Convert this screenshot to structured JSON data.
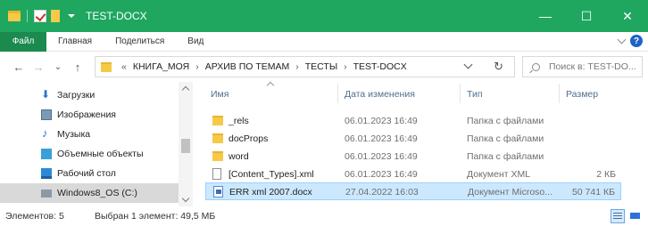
{
  "window": {
    "title": "TEST-DOCX",
    "accent_color": "#1fa760",
    "controls": {
      "minimize": "—",
      "maximize": "☐",
      "close": "✕"
    }
  },
  "ribbon": {
    "tabs": [
      "Файл",
      "Главная",
      "Поделиться",
      "Вид"
    ]
  },
  "address": {
    "back": "←",
    "forward": "→",
    "recent": "⌄",
    "up": "↑",
    "overflow": "«",
    "crumbs": [
      "КНИГА_МОЯ",
      "АРХИВ ПО ТЕМАМ",
      "ТЕСТЫ",
      "TEST-DOCX"
    ],
    "crumb_separator": "›",
    "refresh": "↻"
  },
  "search": {
    "placeholder": "Поиск в: TEST-DO..."
  },
  "nav": {
    "items": [
      {
        "label": "Загрузки",
        "icon": "downloads-icon"
      },
      {
        "label": "Изображения",
        "icon": "pictures-icon"
      },
      {
        "label": "Музыка",
        "icon": "music-icon"
      },
      {
        "label": "Объемные объекты",
        "icon": "3d-objects-icon"
      },
      {
        "label": "Рабочий стол",
        "icon": "desktop-icon"
      },
      {
        "label": "Windows8_OS (C:)",
        "icon": "drive-icon",
        "selected": true
      }
    ]
  },
  "files": {
    "columns": {
      "name": "Имя",
      "date": "Дата изменения",
      "type": "Тип",
      "size": "Размер"
    },
    "rows": [
      {
        "name": "_rels",
        "date": "06.01.2023 16:49",
        "type": "Папка с файлами",
        "size": "",
        "icon": "folder-icon"
      },
      {
        "name": "docProps",
        "date": "06.01.2023 16:49",
        "type": "Папка с файлами",
        "size": "",
        "icon": "folder-icon"
      },
      {
        "name": "word",
        "date": "06.01.2023 16:49",
        "type": "Папка с файлами",
        "size": "",
        "icon": "folder-icon"
      },
      {
        "name": "[Content_Types].xml",
        "date": "06.01.2023 16:49",
        "type": "Документ XML",
        "size": "2 КБ",
        "icon": "xml-file-icon"
      },
      {
        "name": "ERR xml 2007.docx",
        "date": "27.04.2022 16:03",
        "type": "Документ Microso...",
        "size": "50 741 КБ",
        "icon": "docx-file-icon",
        "selected": true
      }
    ]
  },
  "status": {
    "count": "Элементов: 5",
    "selection": "Выбран 1 элемент: 49,5 МБ"
  }
}
